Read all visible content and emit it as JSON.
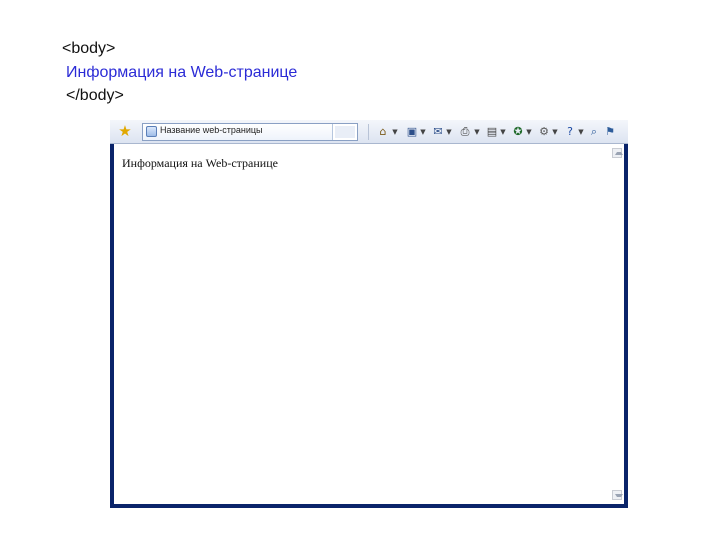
{
  "slide": {
    "code_open": "<body>",
    "code_text": "Информация на Web-странице",
    "code_close": "</body>"
  },
  "browser": {
    "tab_title": "Название web-страницы",
    "page_text": "Информация на Web-странице",
    "icons": {
      "favorites": "star-icon",
      "home": "home-icon",
      "feeds": "feeds-icon",
      "mail": "mail-icon",
      "print": "print-icon",
      "page": "page-icon",
      "safety": "safety-icon",
      "tools": "tools-icon",
      "help": "help-icon",
      "research": "research-icon",
      "dropdown": "dropdown-arrow-icon"
    },
    "colors": {
      "window_frame": "#0a246a",
      "code_text": "#2b2bd6"
    }
  }
}
